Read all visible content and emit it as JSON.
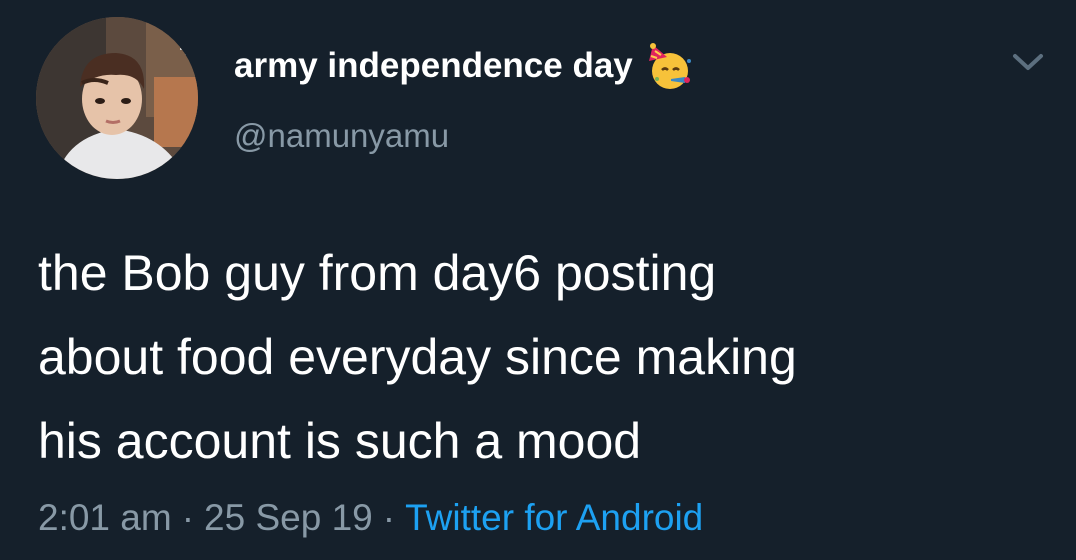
{
  "tweet": {
    "display_name": "army independence day",
    "display_name_emoji": "party-face-icon",
    "handle": "@namunyamu",
    "text_lines": [
      "the Bob guy from day6 posting",
      "about food everyday since making",
      "his account is such a mood"
    ],
    "time": "2:01 am",
    "separator": "·",
    "date": "25 Sep 19",
    "source": "Twitter for Android"
  },
  "colors": {
    "background": "#15202b",
    "text_primary": "#ffffff",
    "text_secondary": "#8899a6",
    "link": "#1da1f2"
  },
  "icons": {
    "menu": "chevron-down-icon"
  }
}
